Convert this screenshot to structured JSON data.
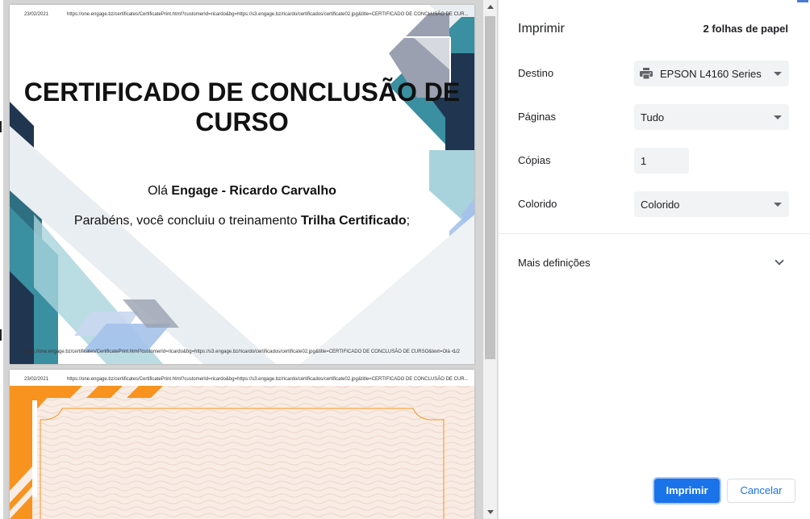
{
  "preview": {
    "page1": {
      "header_date": "23/02/2021",
      "header_url": "https://one.engage.bz/certificates/CertificatePrint.html?customerId=ricardo&bg=https://s3.engage.bz/ricardo/certificados/certificate02.jpg&title=CERTIFICADO DE CONCLUSÃO DE CUR...",
      "footer_url": "https://one.engage.bz/certificates/CertificatePrint.html?customerId=ricardo&bg=https://s3.engage.bz/ricardo/certificados/certificate02.jpg&title=CERTIFICADO DE CONCLUSÃO DE CURSO&text=Olá <...",
      "footer_page": "1/2",
      "title_line1": "CERTIFICADO DE CONCLUSÃO DE",
      "title_line2": "CURSO",
      "hello_prefix": "Olá ",
      "hello_name": "Engage - Ricardo Carvalho",
      "congrats_prefix": "Parabéns, você concluiu o treinamento ",
      "congrats_course": "Trilha Certificado",
      "congrats_suffix": ";"
    },
    "page2": {
      "header_date": "23/02/2021",
      "header_url": "https://one.engage.bz/certificates/CertificatePrint.html?customerId=ricardo&bg=https://s3.engage.bz/ricardo/certificados/certificate02.jpg&title=CERTIFICADO DE CONCLUSÃO DE CUR..."
    }
  },
  "settings": {
    "title": "Imprimir",
    "sheet_count": "2 folhas de papel",
    "destination": {
      "label": "Destino",
      "value": "EPSON L4160 Series",
      "icon": "printer-icon"
    },
    "pages": {
      "label": "Páginas",
      "value": "Tudo"
    },
    "copies": {
      "label": "Cópias",
      "value": "1"
    },
    "color": {
      "label": "Colorido",
      "value": "Colorido"
    },
    "more_settings": {
      "label": "Mais definições",
      "icon": "chevron-down-icon"
    },
    "print_button": "Imprimir",
    "cancel_button": "Cancelar"
  },
  "colors": {
    "accent": "#1a73e8",
    "cert_dark": "#1f3550",
    "cert_teal": "#3a8fa0",
    "cert_gray": "#9aa0b0",
    "page2_orange": "#f7931e",
    "page2_bg": "#f8ece4"
  }
}
